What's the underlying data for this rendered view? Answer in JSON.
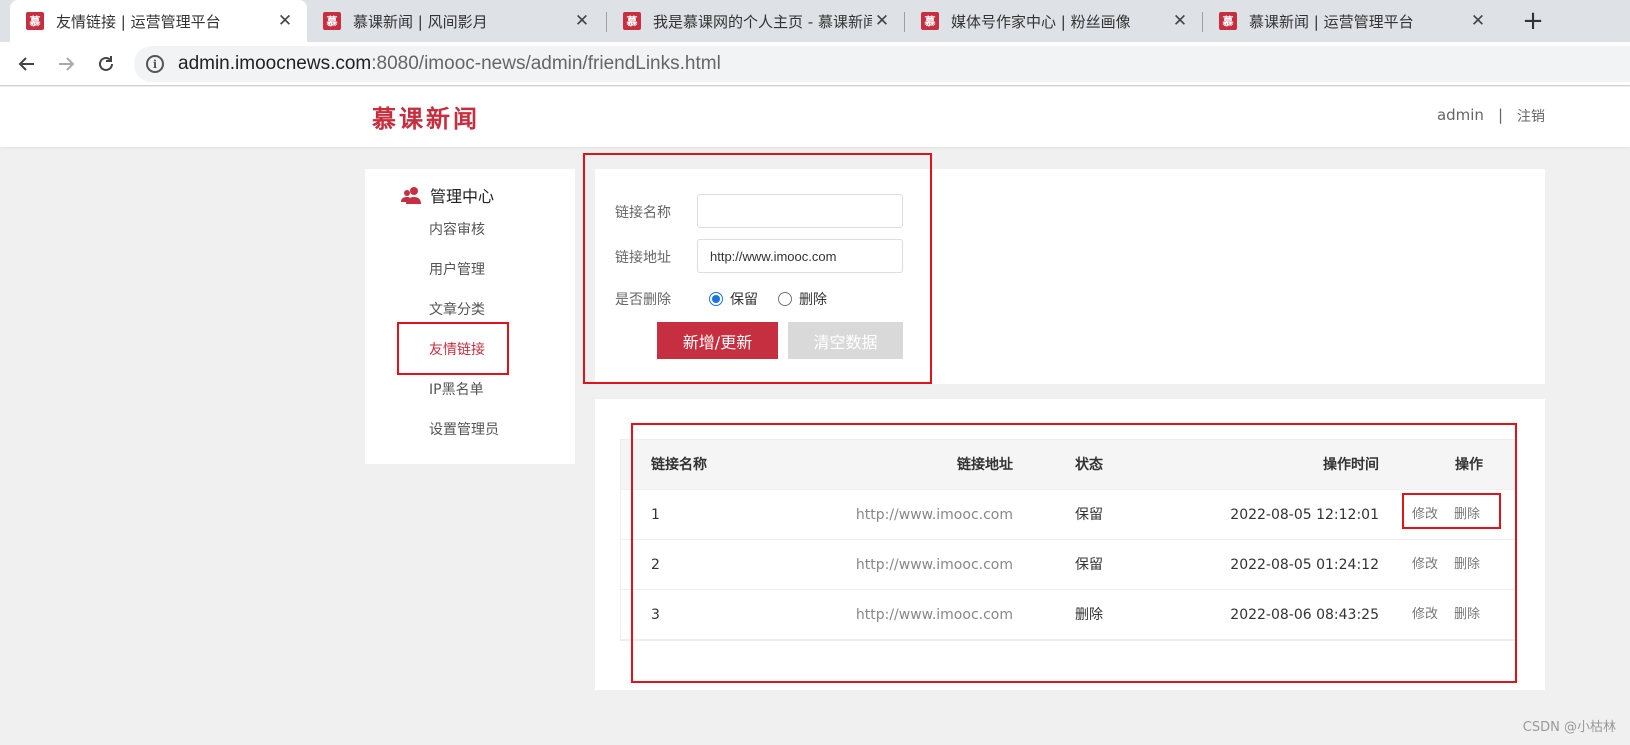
{
  "browser": {
    "tabs": [
      {
        "favicon": "慕",
        "title": "友情链接 | 运营管理平台",
        "active": true
      },
      {
        "favicon": "慕",
        "title": "慕课新闻 | 风间影月",
        "active": false
      },
      {
        "favicon": "慕",
        "title": "我是慕课网的个人主页 - 慕课新闻",
        "active": false
      },
      {
        "favicon": "慕",
        "title": "媒体号作家中心 | 粉丝画像",
        "active": false
      },
      {
        "favicon": "慕",
        "title": "慕课新闻 | 运营管理平台",
        "active": false
      }
    ],
    "close_glyph": "✕",
    "new_tab_glyph": "+",
    "url_host": "admin.imoocnews.com",
    "url_path": ":8080/imooc-news/admin/friendLinks.html",
    "info_glyph": "i"
  },
  "header": {
    "logo": "慕课新闻",
    "user": "admin",
    "separator": "|",
    "logout": "注销"
  },
  "sidebar": {
    "title": "管理中心",
    "items": [
      {
        "label": "内容审核"
      },
      {
        "label": "用户管理"
      },
      {
        "label": "文章分类"
      },
      {
        "label": "友情链接"
      },
      {
        "label": "IP黑名单"
      },
      {
        "label": "设置管理员"
      }
    ],
    "active_index": 3
  },
  "form": {
    "name_label": "链接名称",
    "name_value": "",
    "url_label": "链接地址",
    "url_value": "http://www.imooc.com",
    "delete_label": "是否删除",
    "options": [
      "保留",
      "删除"
    ],
    "selected_option": "保留",
    "submit_label": "新增/更新",
    "clear_label": "清空数据"
  },
  "table": {
    "headers": [
      "链接名称",
      "链接地址",
      "状态",
      "操作时间",
      "操作"
    ],
    "rows": [
      {
        "name": "1",
        "url": "http://www.imooc.com",
        "status": "保留",
        "time": "2022-08-05 12:12:01"
      },
      {
        "name": "2",
        "url": "http://www.imooc.com",
        "status": "保留",
        "time": "2022-08-05 01:24:12"
      },
      {
        "name": "3",
        "url": "http://www.imooc.com",
        "status": "删除",
        "time": "2022-08-06 08:43:25"
      }
    ],
    "edit_label": "修改",
    "delete_label": "删除"
  },
  "watermark": "CSDN @小枯林",
  "colors": {
    "brand": "#c62f3f",
    "annotation": "#e0131b",
    "radio": "#1a73e8"
  }
}
